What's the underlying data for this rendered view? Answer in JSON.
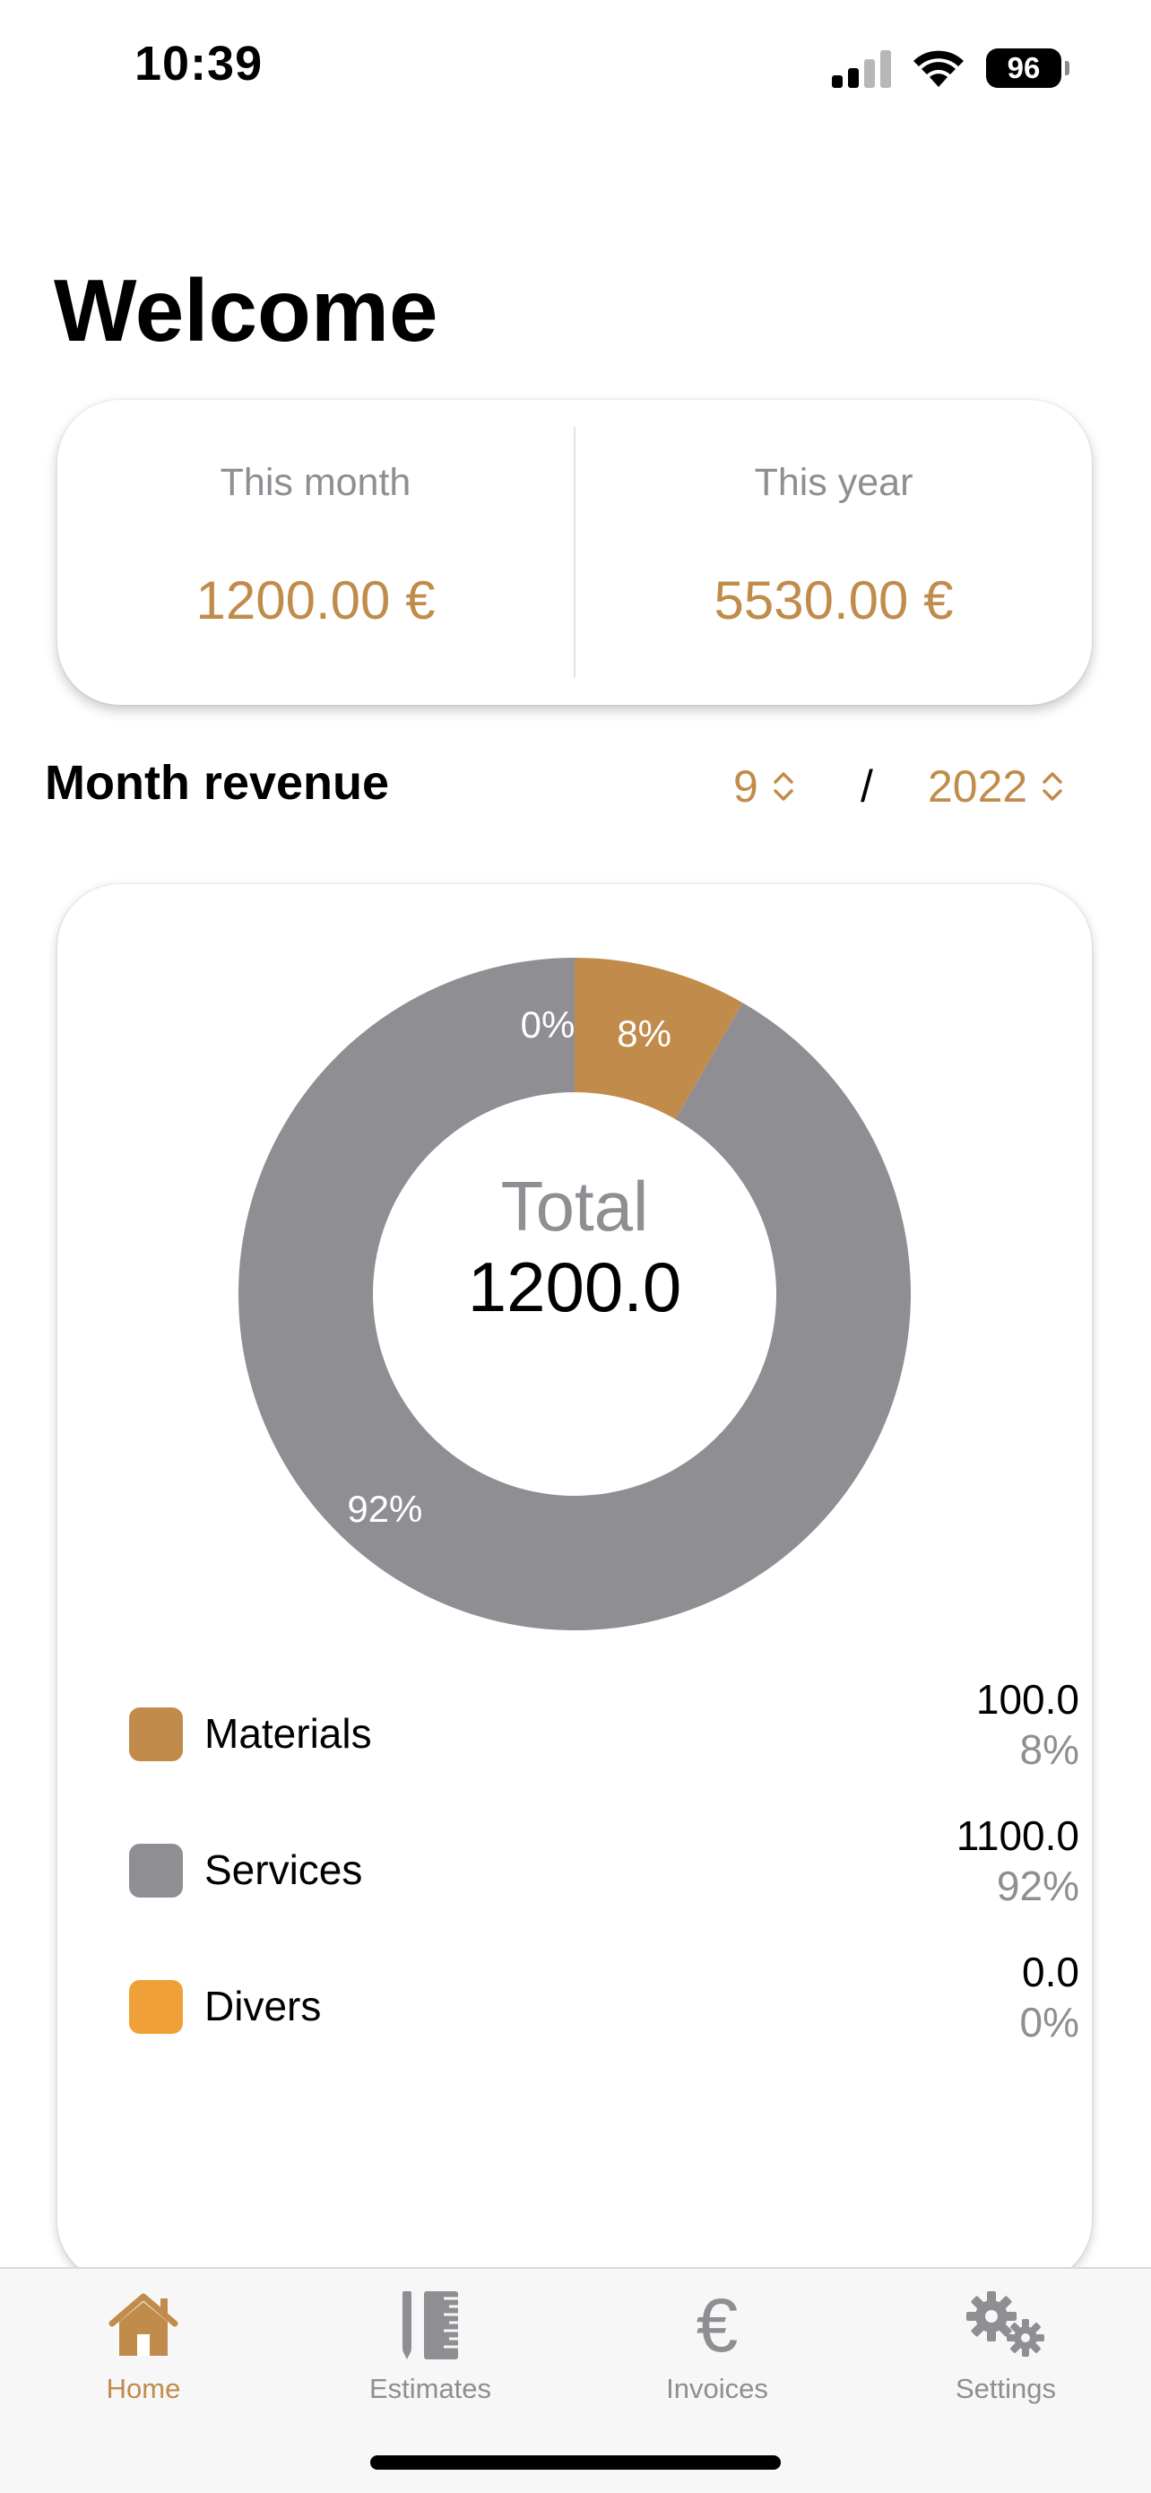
{
  "status_bar": {
    "time": "10:39",
    "battery": "96"
  },
  "page": {
    "title": "Welcome"
  },
  "summary": {
    "this_month_label": "This month",
    "this_month_value": "1200.00 €",
    "this_year_label": "This year",
    "this_year_value": "5530.00 €"
  },
  "month_revenue": {
    "title": "Month revenue",
    "month": "9",
    "separator": "/",
    "year": "2022"
  },
  "chart_data": {
    "type": "pie",
    "center_label": "Total",
    "center_value": "1200.0",
    "categories": [
      "Materials",
      "Services",
      "Divers"
    ],
    "values": [
      100.0,
      1100.0,
      0.0
    ],
    "value_labels": [
      "100.0",
      "1100.0",
      "0.0"
    ],
    "percent_labels": [
      "8%",
      "92%",
      "0%"
    ],
    "colors": [
      "#c18c4b",
      "#8e8e93",
      "#f0a038"
    ]
  },
  "tabs": [
    {
      "label": "Home",
      "icon": "home-icon",
      "active": true
    },
    {
      "label": "Estimates",
      "icon": "ruler-pencil-icon",
      "active": false
    },
    {
      "label": "Invoices",
      "icon": "euro-icon",
      "active": false
    },
    {
      "label": "Settings",
      "icon": "gears-icon",
      "active": false
    }
  ],
  "colors": {
    "accent": "#c18c4b",
    "muted": "#8e8e93"
  }
}
